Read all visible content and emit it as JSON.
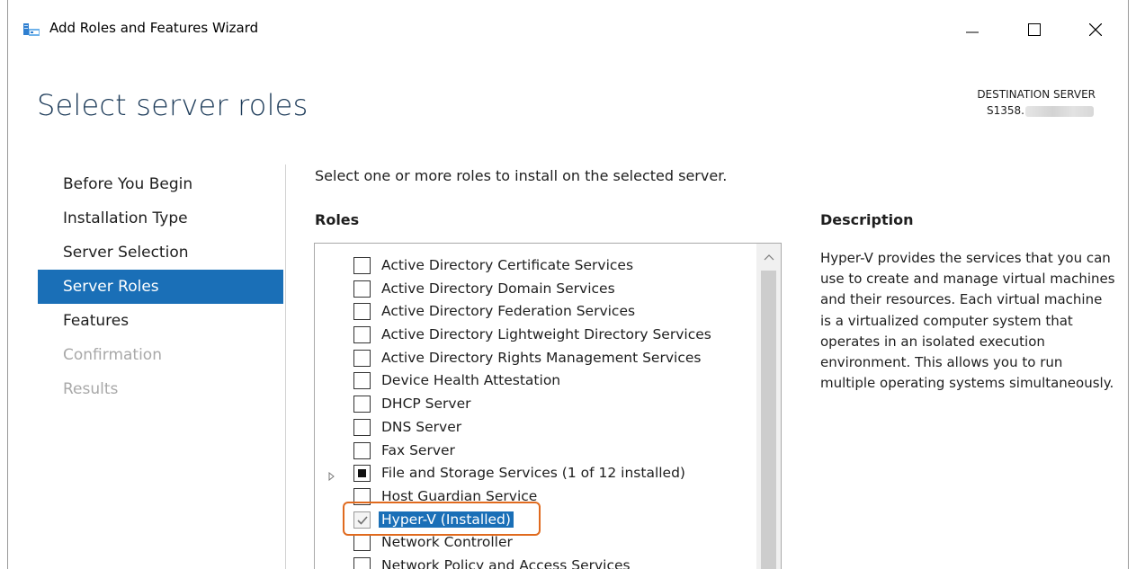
{
  "window": {
    "title": "Add Roles and Features Wizard"
  },
  "page": {
    "title": "Select server roles",
    "destination_label": "DESTINATION SERVER",
    "destination_server": "S1358."
  },
  "nav": {
    "items": [
      {
        "label": "Before You Begin",
        "state": "normal"
      },
      {
        "label": "Installation Type",
        "state": "normal"
      },
      {
        "label": "Server Selection",
        "state": "normal"
      },
      {
        "label": "Server Roles",
        "state": "active"
      },
      {
        "label": "Features",
        "state": "normal"
      },
      {
        "label": "Confirmation",
        "state": "disabled"
      },
      {
        "label": "Results",
        "state": "disabled"
      }
    ]
  },
  "main": {
    "instruction": "Select one or more roles to install on the selected server.",
    "roles_header": "Roles",
    "description_header": "Description",
    "description_text": "Hyper-V provides the services that you can use to create and manage virtual machines and their resources. Each virtual machine is a virtualized computer system that operates in an isolated execution environment. This allows you to run multiple operating systems simultaneously.",
    "roles": [
      {
        "label": "Active Directory Certificate Services",
        "state": "unchecked"
      },
      {
        "label": "Active Directory Domain Services",
        "state": "unchecked"
      },
      {
        "label": "Active Directory Federation Services",
        "state": "unchecked"
      },
      {
        "label": "Active Directory Lightweight Directory Services",
        "state": "unchecked"
      },
      {
        "label": "Active Directory Rights Management Services",
        "state": "unchecked"
      },
      {
        "label": "Device Health Attestation",
        "state": "unchecked"
      },
      {
        "label": "DHCP Server",
        "state": "unchecked"
      },
      {
        "label": "DNS Server",
        "state": "unchecked"
      },
      {
        "label": "Fax Server",
        "state": "unchecked"
      },
      {
        "label": "File and Storage Services (1 of 12 installed)",
        "state": "partial"
      },
      {
        "label": "Host Guardian Service",
        "state": "unchecked"
      },
      {
        "label": "Hyper-V (Installed)",
        "state": "checked-disabled"
      },
      {
        "label": "Network Controller",
        "state": "unchecked"
      },
      {
        "label": "Network Policy and Access Services",
        "state": "unchecked"
      }
    ]
  },
  "colors": {
    "accent": "#1a6fb7",
    "title": "#1e3c5a",
    "highlight": "#e06a1e",
    "disabled_text": "#a8a8a8"
  }
}
